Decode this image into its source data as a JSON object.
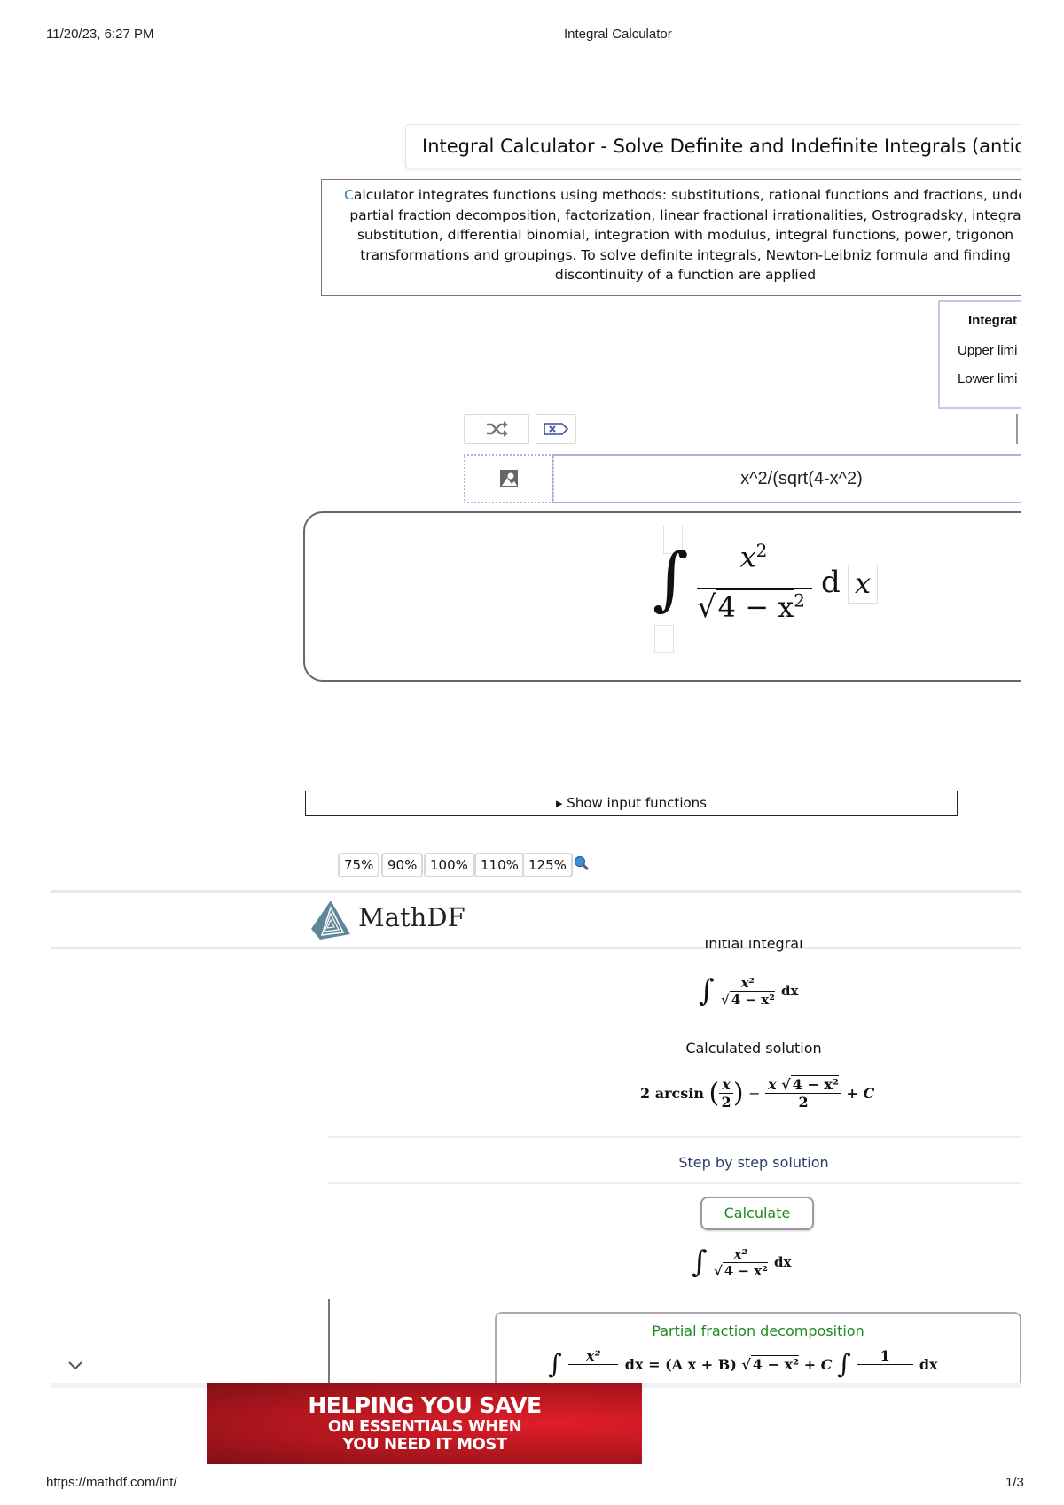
{
  "print_header": {
    "datetime": "11/20/23, 6:27 PM",
    "page_title": "Integral Calculator"
  },
  "print_footer": {
    "url": "https://mathdf.com/int/",
    "page": "1/3"
  },
  "page": {
    "heading": "Integral Calculator - Solve Definite and Indefinite Integrals (antideri",
    "description": {
      "first_letter": "C",
      "lines": [
        "alculator integrates functions using methods: substitutions, rational functions and fractions, unde",
        "partial fraction decomposition, factorization, linear fractional irrationalities, Ostrogradsky, integra",
        "substitution, differential binomial, integration with modulus, integral functions, power, trigonon",
        "transformations and groupings. To solve definite integrals, Newton-Leibniz formula and finding",
        "discontinuity of a function are applied"
      ]
    },
    "side_panel": {
      "integrate_label": "Integrat",
      "upper_limit_label": "Upper limi",
      "lower_limit_label": "Lower limi"
    }
  },
  "toolbar": {
    "shuffle_icon": "shuffle-icon",
    "clear_icon": "backspace-clear-icon",
    "image_icon": "image-icon"
  },
  "input": {
    "expression": "x^2/(sqrt(4-x^2)"
  },
  "preview": {
    "integral_sign": "∫",
    "numerator": "x",
    "numerator_exp": "2",
    "denominator_radicand": "4 − x",
    "denominator_exp": "2",
    "differential": "d",
    "variable": "x"
  },
  "show_input_functions": "▸ Show input functions",
  "zoom_options": [
    "75%",
    "90%",
    "100%",
    "110%",
    "125%"
  ],
  "logo_text": "MathDF",
  "results": {
    "initial_label": "Initial integral",
    "initial_math": {
      "integral": "∫",
      "num": "x²",
      "den": "4 − x²",
      "diff": "dx"
    },
    "solution_label": "Calculated solution",
    "solution_math": {
      "coef": "2 arcsin",
      "arg_num": "x",
      "arg_den": "2",
      "minus": "−",
      "frac_num_x": "x",
      "frac_num_rad": "4 − x²",
      "frac_den": "2",
      "const": "+ C"
    },
    "step_link": "Step by step solution",
    "calculate_button": "Calculate",
    "step_math": {
      "integral": "∫",
      "num": "x²",
      "den": "4 − x²",
      "diff": "dx"
    },
    "step_title": "Partial fraction decomposition",
    "step_formula": {
      "lhs_num": "x²",
      "eq": "dx = (A x + B)",
      "rad": "4 − x²",
      "plus_c": "+ C",
      "rhs_num": "1",
      "rhs_diff": "dx"
    }
  },
  "ad": {
    "line1": "HELPING YOU SAVE",
    "line2": "ON ESSENTIALS WHEN",
    "line3": "YOU NEED IT MOST"
  },
  "colors": {
    "accent_green": "#1d8a1d",
    "link_navy": "#2b3a6b",
    "input_border": "#a9b0e3",
    "logo": "#5f8799",
    "ad_red": "#c8161f"
  }
}
